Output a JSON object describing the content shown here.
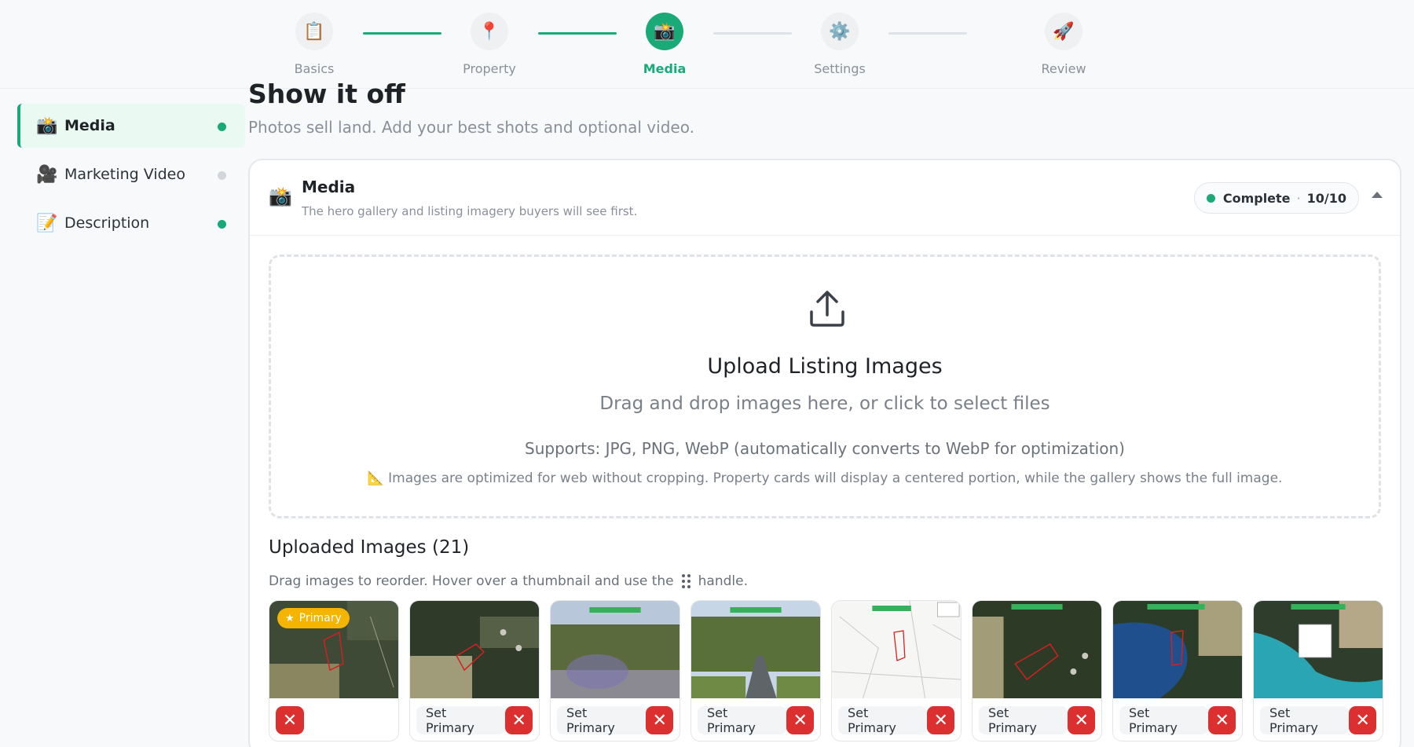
{
  "stepper": {
    "steps": [
      {
        "label": "Basics",
        "icon": "📋",
        "icon_name": "clipboard-icon"
      },
      {
        "label": "Property",
        "icon": "📍",
        "icon_name": "pin-icon"
      },
      {
        "label": "Media",
        "icon": "📸",
        "icon_name": "camera-icon"
      },
      {
        "label": "Settings",
        "icon": "⚙️",
        "icon_name": "gear-icon"
      },
      {
        "label": "Review",
        "icon": "🚀",
        "icon_name": "rocket-icon"
      }
    ],
    "active_index": 2
  },
  "sidebar": {
    "items": [
      {
        "label": "Media",
        "icon": "📸",
        "status": "complete"
      },
      {
        "label": "Marketing Video",
        "icon": "🎥",
        "status": "incomplete"
      },
      {
        "label": "Description",
        "icon": "📝",
        "status": "complete"
      }
    ]
  },
  "page": {
    "title": "Show it off",
    "subtitle": "Photos sell land. Add your best shots and optional video."
  },
  "card": {
    "icon": "📸",
    "title": "Media",
    "subtitle": "The hero gallery and listing imagery buyers will see first.",
    "status_label": "Complete",
    "status_count": "10/10"
  },
  "dropzone": {
    "title": "Upload Listing Images",
    "subtitle": "Drag and drop images here, or click to select files",
    "supports": "Supports: JPG, PNG, WebP (automatically converts to WebP for optimization)",
    "note_icon": "📐",
    "note": "Images are optimized for web without cropping. Property cards will display a centered portion, while the gallery shows the full image."
  },
  "uploaded": {
    "title": "Uploaded Images (21)",
    "hint_before": "Drag images to reorder. Hover over a thumbnail and use the",
    "hint_after": "handle.",
    "primary_label": "Primary",
    "set_primary_label": "Set Primary",
    "delete_glyph": "✕",
    "thumbnails": [
      {
        "kind": "aerial-dark",
        "primary": true
      },
      {
        "kind": "aerial-field",
        "primary": false
      },
      {
        "kind": "street-trees",
        "primary": false
      },
      {
        "kind": "road",
        "primary": false
      },
      {
        "kind": "gis-map",
        "primary": false
      },
      {
        "kind": "aerial-dims",
        "primary": false
      },
      {
        "kind": "wetlands-blue",
        "primary": false
      },
      {
        "kind": "floodplain",
        "primary": false
      }
    ]
  },
  "colors": {
    "accent": "#1aaa78",
    "danger": "#dc2f2f",
    "primary_badge": "#f4b400"
  }
}
